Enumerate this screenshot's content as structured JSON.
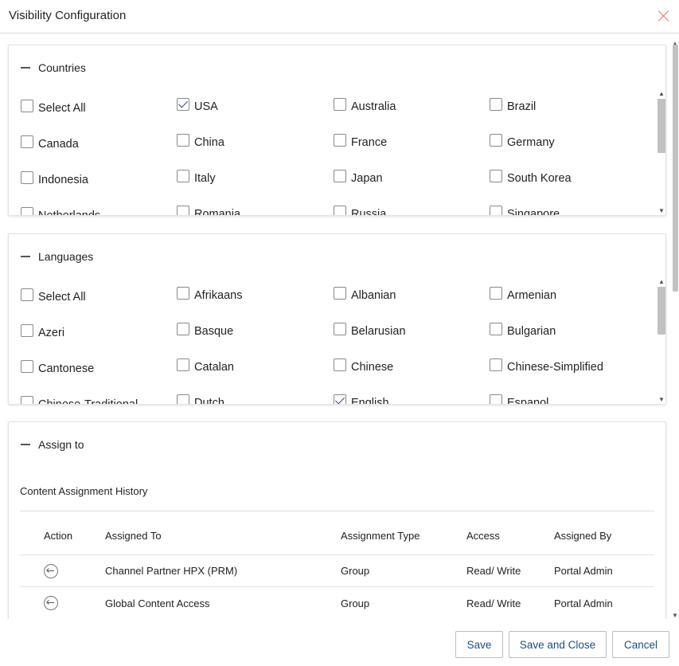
{
  "dialog": {
    "title": "Visibility Configuration"
  },
  "countries": {
    "title": "Countries",
    "options": [
      {
        "label": "Select All",
        "checked": false
      },
      {
        "label": "USA",
        "checked": true
      },
      {
        "label": "Australia",
        "checked": false
      },
      {
        "label": "Brazil",
        "checked": false
      },
      {
        "label": "Canada",
        "checked": false
      },
      {
        "label": "China",
        "checked": false
      },
      {
        "label": "France",
        "checked": false
      },
      {
        "label": "Germany",
        "checked": false
      },
      {
        "label": "Indonesia",
        "checked": false
      },
      {
        "label": "Italy",
        "checked": false
      },
      {
        "label": "Japan",
        "checked": false
      },
      {
        "label": "South Korea",
        "checked": false
      },
      {
        "label": "Netherlands",
        "checked": false
      },
      {
        "label": "Romania",
        "checked": false
      },
      {
        "label": "Russia",
        "checked": false
      },
      {
        "label": "Singapore",
        "checked": false
      }
    ]
  },
  "languages": {
    "title": "Languages",
    "options": [
      {
        "label": "Select All",
        "checked": false
      },
      {
        "label": "Afrikaans",
        "checked": false
      },
      {
        "label": "Albanian",
        "checked": false
      },
      {
        "label": "Armenian",
        "checked": false
      },
      {
        "label": "Azeri",
        "checked": false
      },
      {
        "label": "Basque",
        "checked": false
      },
      {
        "label": "Belarusian",
        "checked": false
      },
      {
        "label": "Bulgarian",
        "checked": false
      },
      {
        "label": "Cantonese",
        "checked": false
      },
      {
        "label": "Catalan",
        "checked": false
      },
      {
        "label": "Chinese",
        "checked": false
      },
      {
        "label": "Chinese-Simplified",
        "checked": false
      },
      {
        "label": "Chinese-Traditional",
        "checked": false
      },
      {
        "label": "Dutch",
        "checked": false
      },
      {
        "label": "English",
        "checked": true
      },
      {
        "label": "Espanol",
        "checked": false
      }
    ]
  },
  "assign": {
    "title": "Assign to",
    "history_title": "Content Assignment History",
    "columns": {
      "action": "Action",
      "assigned_to": "Assigned To",
      "type": "Assignment Type",
      "access": "Access",
      "assigned_by": "Assigned By"
    },
    "rows": [
      {
        "assigned_to": "Channel Partner HPX (PRM)",
        "type": "Group",
        "access": "Read/ Write",
        "assigned_by": "Portal Admin"
      },
      {
        "assigned_to": "Global Content Access",
        "type": "Group",
        "access": "Read/ Write",
        "assigned_by": "Portal Admin"
      }
    ]
  },
  "footer": {
    "save": "Save",
    "save_close": "Save and Close",
    "cancel": "Cancel"
  },
  "colors": {
    "accent": "#1e4d80",
    "close": "#e07a6a"
  }
}
